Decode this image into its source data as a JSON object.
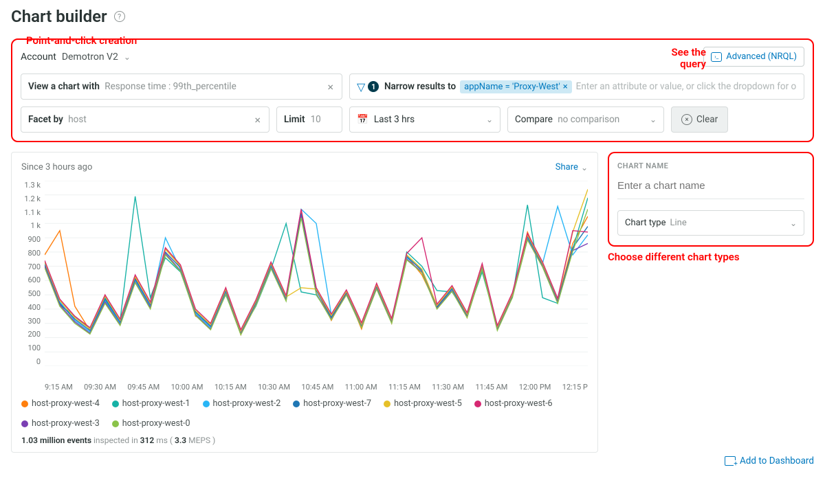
{
  "header": {
    "title": "Chart builder"
  },
  "annotations": {
    "point_click": "Point-and-click creation",
    "see_query": "See the\nquery",
    "choose_types": "Choose different chart types"
  },
  "account": {
    "label": "Account",
    "value": "Demotron V2"
  },
  "advanced": {
    "label": "Advanced (NRQL)"
  },
  "query": {
    "view_prefix": "View a chart with",
    "view_value": "Response time : 99th_percentile",
    "narrow_prefix": "Narrow results to",
    "narrow_chip": "appName = 'Proxy-West'",
    "narrow_placeholder": "Enter an attribute or value, or click the dropdown for options",
    "funnel_count": "1",
    "facet_prefix": "Facet by",
    "facet_value": "host",
    "limit_prefix": "Limit",
    "limit_value": "10",
    "time_value": "Last 3 hrs",
    "compare_prefix": "Compare",
    "compare_value": "no comparison",
    "clear": "Clear"
  },
  "chart": {
    "since": "Since 3 hours ago",
    "share": "Share",
    "stats_events": "1.03 million events",
    "stats_mid": " inspected in ",
    "stats_ms": "312",
    "stats_ms_unit": " ms ( ",
    "stats_meps": "3.3",
    "stats_meps_unit": " MEPS )"
  },
  "side": {
    "name_label": "CHART NAME",
    "name_placeholder": "Enter a chart name",
    "type_prefix": "Chart type",
    "type_value": "Line",
    "add_dash": "Add to Dashboard"
  },
  "legend": [
    {
      "name": "host-proxy-west-4",
      "color": "#ff7f0e"
    },
    {
      "name": "host-proxy-west-1",
      "color": "#17b2a6"
    },
    {
      "name": "host-proxy-west-2",
      "color": "#29b6f6"
    },
    {
      "name": "host-proxy-west-7",
      "color": "#1f77b4"
    },
    {
      "name": "host-proxy-west-5",
      "color": "#e6c029"
    },
    {
      "name": "host-proxy-west-6",
      "color": "#d62872"
    },
    {
      "name": "host-proxy-west-3",
      "color": "#7b3fb3"
    },
    {
      "name": "host-proxy-west-0",
      "color": "#8bc34a"
    }
  ],
  "chart_data": {
    "type": "line",
    "title": "",
    "xlabel": "",
    "ylabel": "",
    "ylim": [
      0,
      1300
    ],
    "y_ticks": [
      "1.3 k",
      "1.2 k",
      "1.1 k",
      "1 k",
      "900",
      "800",
      "700",
      "600",
      "500",
      "400",
      "300",
      "200",
      "100",
      "0"
    ],
    "x_ticks": [
      "9:15 AM",
      "09:30 AM",
      "09:45 AM",
      "10:00 AM",
      "10:15 AM",
      "10:30 AM",
      "10:45 AM",
      "11:00 AM",
      "11:15 AM",
      "11:30 AM",
      "11:45 AM",
      "12:00 PM",
      "12:15 P"
    ],
    "x": [
      0,
      1,
      2,
      3,
      4,
      5,
      6,
      7,
      8,
      9,
      10,
      11,
      12,
      13,
      14,
      15,
      16,
      17,
      18,
      19,
      20,
      21,
      22,
      23,
      24,
      25,
      26,
      27,
      28,
      29,
      30,
      31,
      32,
      33,
      34,
      35,
      36
    ],
    "series": [
      {
        "name": "host-proxy-west-4",
        "color": "#ff7f0e",
        "values": [
          780,
          950,
          420,
          250,
          500,
          300,
          620,
          410,
          820,
          700,
          350,
          300,
          550,
          220,
          450,
          720,
          480,
          1080,
          540,
          320,
          520,
          260,
          580,
          300,
          770,
          640,
          420,
          560,
          340,
          700,
          260,
          500,
          940,
          700,
          460,
          860,
          1050
        ]
      },
      {
        "name": "host-proxy-west-1",
        "color": "#17b2a6",
        "values": [
          700,
          430,
          350,
          260,
          480,
          320,
          1190,
          480,
          760,
          660,
          380,
          280,
          500,
          240,
          420,
          680,
          1000,
          520,
          500,
          340,
          500,
          280,
          550,
          310,
          800,
          700,
          530,
          520,
          360,
          660,
          280,
          480,
          1130,
          480,
          440,
          820,
          1180
        ]
      },
      {
        "name": "host-proxy-west-2",
        "color": "#29b6f6",
        "values": [
          720,
          450,
          320,
          240,
          460,
          300,
          600,
          420,
          900,
          680,
          370,
          270,
          520,
          230,
          440,
          700,
          470,
          1100,
          1000,
          360,
          520,
          290,
          560,
          320,
          760,
          680,
          410,
          540,
          350,
          700,
          260,
          490,
          900,
          720,
          1120,
          780,
          920
        ]
      },
      {
        "name": "host-proxy-west-7",
        "color": "#1f77b4",
        "values": [
          710,
          440,
          330,
          250,
          470,
          310,
          610,
          430,
          800,
          690,
          380,
          280,
          530,
          235,
          445,
          710,
          475,
          1070,
          530,
          345,
          515,
          285,
          560,
          315,
          770,
          670,
          415,
          545,
          355,
          695,
          265,
          495,
          910,
          710,
          455,
          830,
          980
        ]
      },
      {
        "name": "host-proxy-west-5",
        "color": "#e6c029",
        "values": [
          730,
          460,
          340,
          260,
          490,
          320,
          630,
          440,
          820,
          700,
          390,
          290,
          540,
          245,
          455,
          720,
          485,
          550,
          540,
          355,
          525,
          295,
          570,
          325,
          780,
          680,
          425,
          555,
          365,
          710,
          275,
          505,
          920,
          720,
          470,
          940,
          1240
        ]
      },
      {
        "name": "host-proxy-west-6",
        "color": "#d62872",
        "values": [
          740,
          470,
          350,
          270,
          500,
          330,
          640,
          450,
          830,
          710,
          400,
          300,
          550,
          255,
          465,
          730,
          495,
          1100,
          550,
          365,
          535,
          305,
          580,
          335,
          790,
          900,
          435,
          565,
          375,
          720,
          285,
          515,
          930,
          730,
          475,
          950,
          940
        ]
      },
      {
        "name": "host-proxy-west-3",
        "color": "#7b3fb3",
        "values": [
          700,
          430,
          310,
          230,
          450,
          290,
          590,
          410,
          790,
          670,
          360,
          260,
          510,
          225,
          430,
          690,
          460,
          1050,
          510,
          330,
          505,
          275,
          545,
          305,
          750,
          660,
          405,
          530,
          345,
          685,
          255,
          485,
          890,
          700,
          445,
          810,
          860
        ]
      },
      {
        "name": "host-proxy-west-0",
        "color": "#8bc34a",
        "values": [
          690,
          420,
          300,
          225,
          440,
          285,
          585,
          400,
          780,
          665,
          355,
          255,
          505,
          220,
          425,
          685,
          455,
          1040,
          505,
          325,
          500,
          270,
          540,
          300,
          745,
          655,
          400,
          525,
          340,
          680,
          250,
          480,
          885,
          695,
          440,
          805,
          1100
        ]
      }
    ]
  }
}
